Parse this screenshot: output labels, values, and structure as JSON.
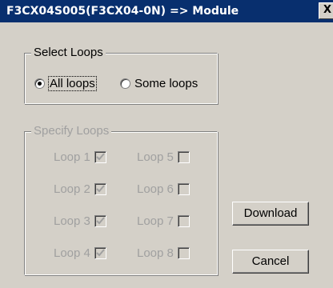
{
  "window": {
    "title": "F3CX04S005(F3CX04-0N) => Module",
    "close_glyph": "X"
  },
  "select_loops": {
    "legend": "Select Loops",
    "options": [
      {
        "label": "All loops",
        "checked": true
      },
      {
        "label": "Some loops",
        "checked": false
      }
    ]
  },
  "specify_loops": {
    "legend": "Specify Loops",
    "enabled": false,
    "loops": [
      {
        "label": "Loop 1",
        "checked": true
      },
      {
        "label": "Loop 2",
        "checked": true
      },
      {
        "label": "Loop 3",
        "checked": true
      },
      {
        "label": "Loop 4",
        "checked": true
      },
      {
        "label": "Loop 5",
        "checked": false
      },
      {
        "label": "Loop 6",
        "checked": false
      },
      {
        "label": "Loop 7",
        "checked": false
      },
      {
        "label": "Loop 8",
        "checked": false
      }
    ]
  },
  "buttons": {
    "download_label": "Download",
    "cancel_label": "Cancel"
  },
  "colors": {
    "titlebar": "#082f6e",
    "face": "#d4d0c8",
    "disabled_text": "#a0a0a0"
  }
}
